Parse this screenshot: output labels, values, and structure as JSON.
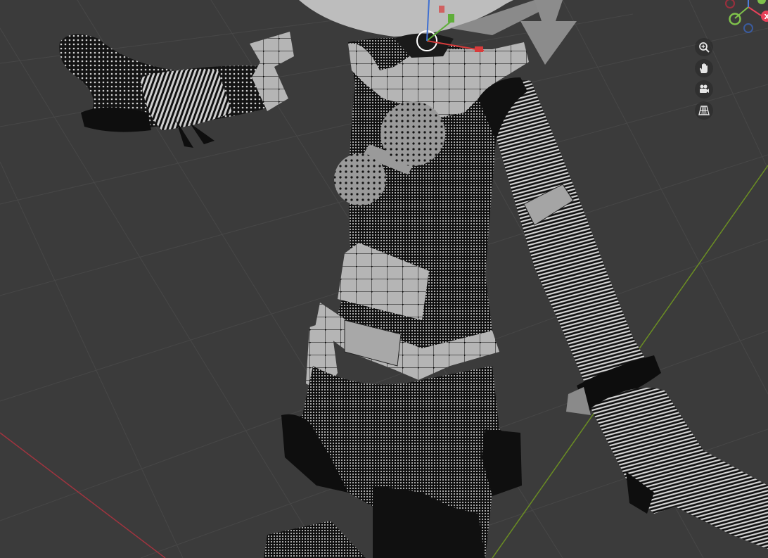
{
  "viewport": {
    "background_color": "#3c3c3c",
    "grid_line_color": "#4a4a4a",
    "x_axis_color": "#a0343f",
    "y_axis_color": "#6b8e23",
    "mesh_dark_color": "#0e0e0e",
    "mesh_light_color": "#bdbdbd",
    "vertex_color": "#000000"
  },
  "navigation_gizmo": {
    "x_label": "X",
    "x_color": "#e8415a",
    "y_color": "#7fc14b",
    "z_color": "#4e7ddb",
    "neg_x_color": "#9c2f3d",
    "neg_z_color": "#3a5b9e"
  },
  "tools": [
    {
      "name": "zoom",
      "icon": "zoom-in-icon"
    },
    {
      "name": "pan",
      "icon": "hand-icon"
    },
    {
      "name": "camera",
      "icon": "camera-icon"
    },
    {
      "name": "perspective",
      "icon": "grid-perspective-icon"
    }
  ]
}
